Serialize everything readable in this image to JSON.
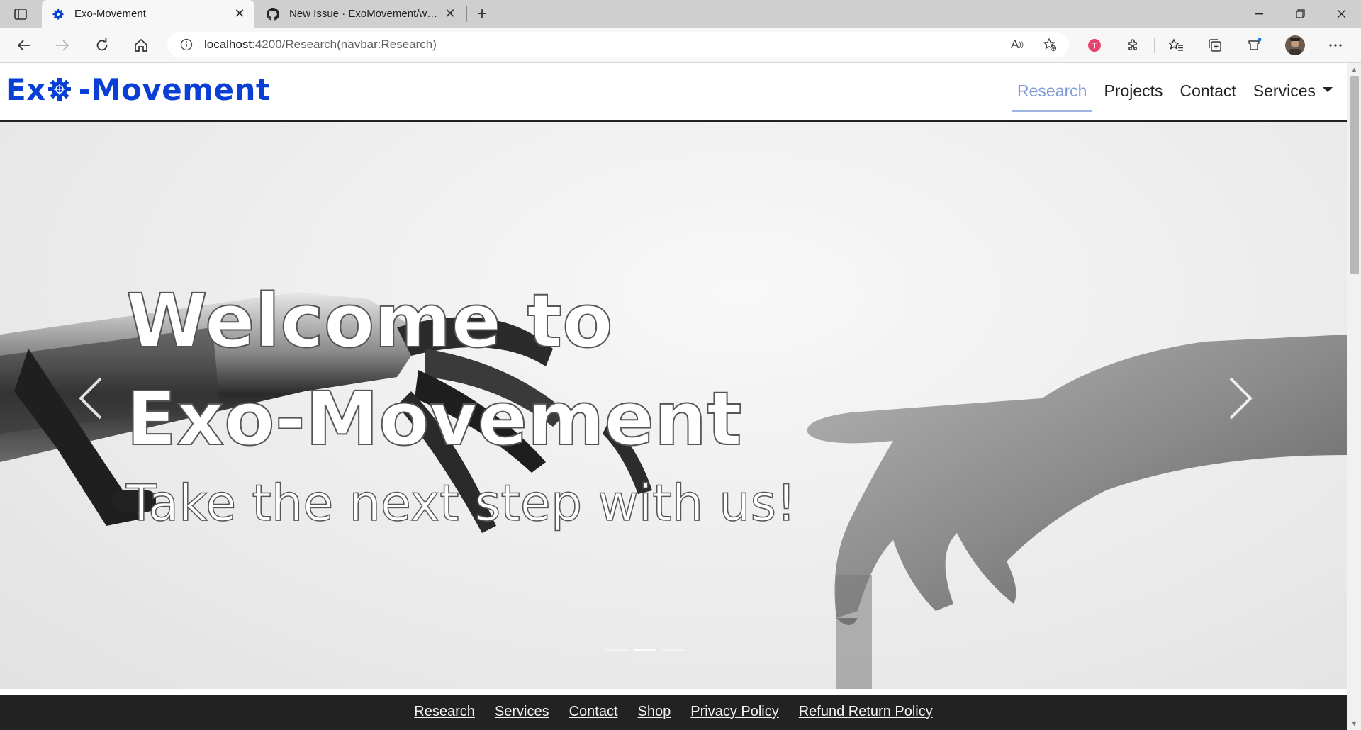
{
  "browser": {
    "tabs": [
      {
        "title": "Exo-Movement",
        "active": true,
        "favicon": "exo-gear-icon"
      },
      {
        "title": "New Issue · ExoMovement/website",
        "active": false,
        "favicon": "github-icon"
      }
    ],
    "url_host": "localhost",
    "url_rest": ":4200/Research(navbar:Research)"
  },
  "site": {
    "logo_left": "Ex",
    "logo_right": "-Movement",
    "nav": [
      {
        "label": "Research",
        "active": true
      },
      {
        "label": "Projects",
        "active": false
      },
      {
        "label": "Contact",
        "active": false
      },
      {
        "label": "Services",
        "active": false,
        "dropdown": true
      }
    ],
    "hero": {
      "line1": "Welcome to",
      "line2": "Exo-Movement",
      "line3": "Take the next step with us!"
    },
    "footer_links": [
      "Research",
      "Services",
      "Contact",
      "Shop",
      "Privacy Policy",
      "Refund Return Policy"
    ]
  },
  "colors": {
    "logo_blue": "#0a3fd6",
    "nav_active": "#7d9dd8",
    "footer_bg": "#222222"
  }
}
